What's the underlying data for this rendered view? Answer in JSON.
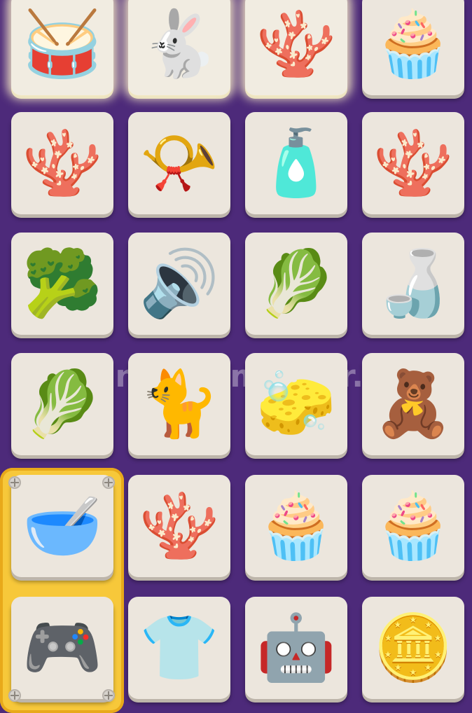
{
  "watermark": "Connect-master.org",
  "colors": {
    "background": "#4d2a7a",
    "tile": "#ece6dd",
    "selection_frame": "#f7c83a"
  },
  "tiles": [
    {
      "name": "drum",
      "emoji": "🥁",
      "glow": true
    },
    {
      "name": "rabbit",
      "emoji": "🐇",
      "glow": true
    },
    {
      "name": "coral",
      "emoji": "🪸",
      "glow": true
    },
    {
      "name": "muffin",
      "emoji": "🧁",
      "glow": false
    },
    {
      "name": "coral",
      "emoji": "🪸",
      "glow": false
    },
    {
      "name": "whistle",
      "emoji": "📯",
      "glow": false
    },
    {
      "name": "toothpaste-tube",
      "emoji": "🧴",
      "glow": false
    },
    {
      "name": "coral",
      "emoji": "🪸",
      "glow": false
    },
    {
      "name": "cauliflower",
      "emoji": "🥦",
      "glow": false
    },
    {
      "name": "speaker",
      "emoji": "🔊",
      "glow": false
    },
    {
      "name": "lettuce",
      "emoji": "🥬",
      "glow": false
    },
    {
      "name": "water-bottle",
      "emoji": "🍶",
      "glow": false
    },
    {
      "name": "cabbage",
      "emoji": "🥬",
      "glow": false
    },
    {
      "name": "cat",
      "emoji": "🐈",
      "glow": false
    },
    {
      "name": "sponge",
      "emoji": "🧽",
      "glow": false
    },
    {
      "name": "bear",
      "emoji": "🧸",
      "glow": false
    },
    {
      "name": "stacked-bowls",
      "emoji": "🥣",
      "glow": false
    },
    {
      "name": "coral",
      "emoji": "🪸",
      "glow": false
    },
    {
      "name": "muffin",
      "emoji": "🧁",
      "glow": false
    },
    {
      "name": "muffin",
      "emoji": "🧁",
      "glow": false
    },
    {
      "name": "game-controller",
      "emoji": "🎮",
      "glow": false
    },
    {
      "name": "shirt",
      "emoji": "👕",
      "glow": false
    },
    {
      "name": "robot",
      "emoji": "🤖",
      "glow": false
    },
    {
      "name": "coin-stack",
      "emoji": "🪙",
      "glow": false
    }
  ]
}
